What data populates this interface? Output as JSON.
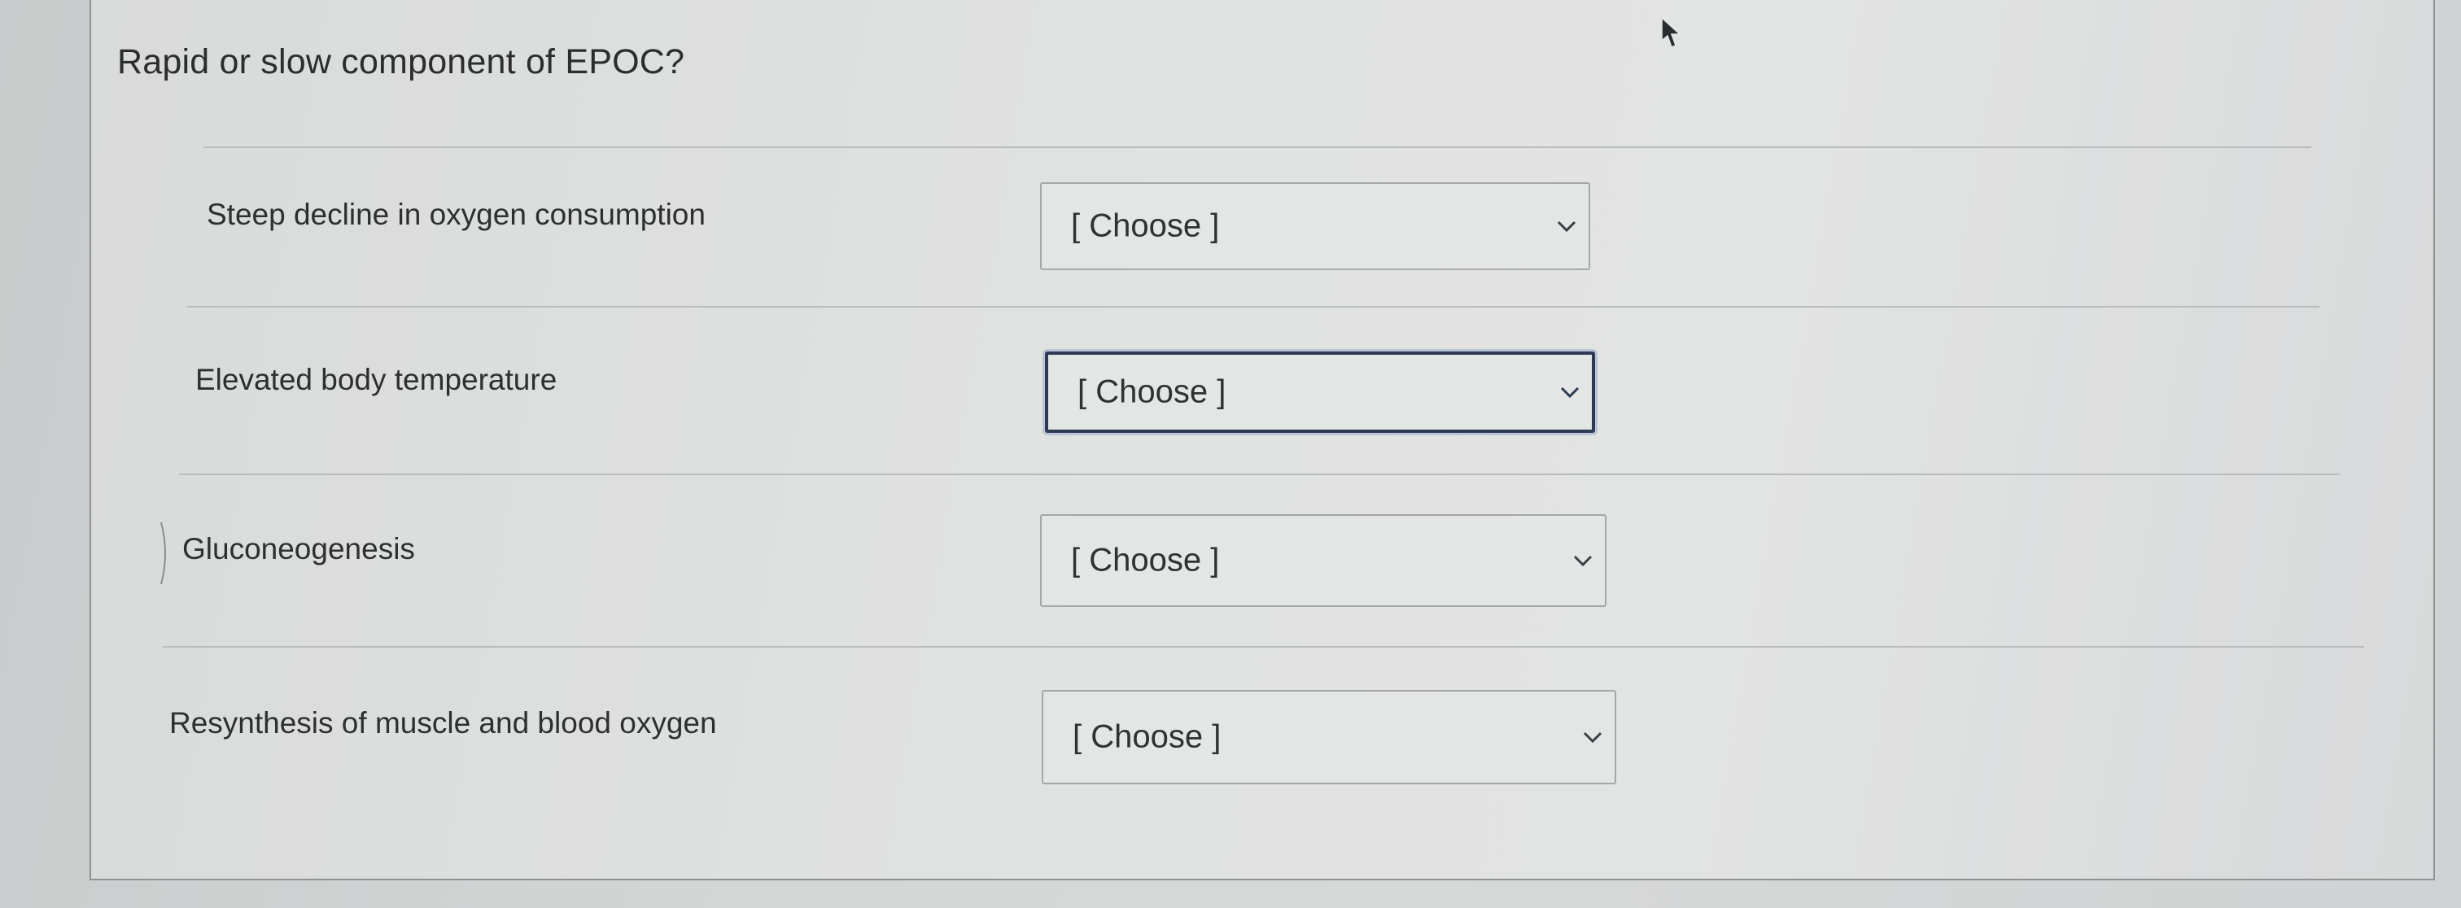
{
  "question": {
    "title": "Rapid or slow component of EPOC?"
  },
  "rows": [
    {
      "label": "Steep decline in oxygen consumption",
      "select_value": "[ Choose ]"
    },
    {
      "label": "Elevated body temperature",
      "select_value": "[ Choose ]"
    },
    {
      "label": "Gluconeogenesis",
      "select_value": "[ Choose ]"
    },
    {
      "label": "Resynthesis of muscle and blood oxygen",
      "select_value": "[ Choose ]"
    }
  ],
  "icons": {
    "dropdown": "chevron-down-icon",
    "pointer": "mouse-cursor-icon"
  },
  "colors": {
    "focus_border": "#2d3a52",
    "text": "#2d2f31"
  }
}
